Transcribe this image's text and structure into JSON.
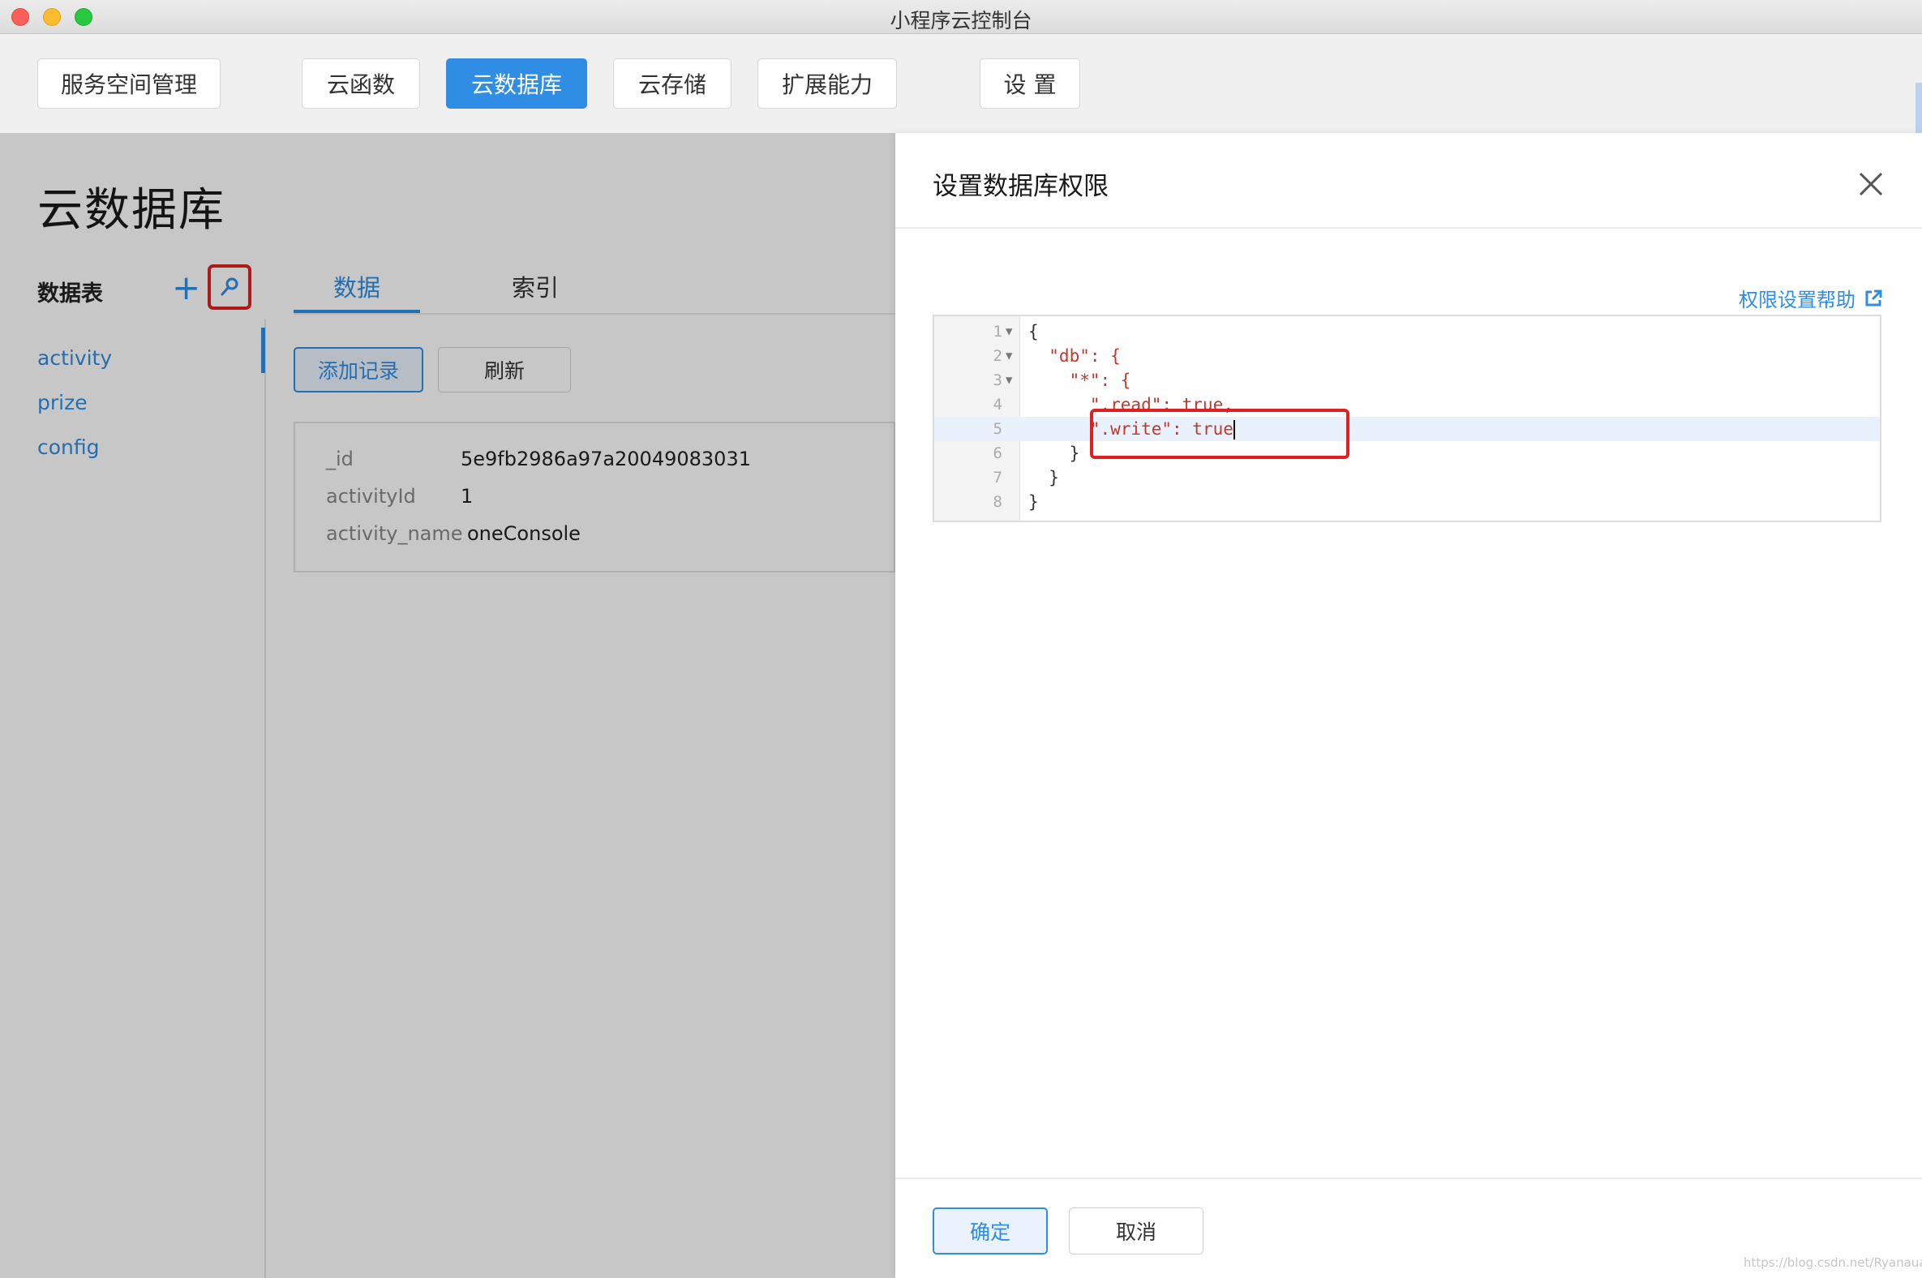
{
  "window": {
    "title": "小程序云控制台"
  },
  "nav": {
    "items": [
      {
        "label": "服务空间管理"
      },
      {
        "label": "云函数"
      },
      {
        "label": "云数据库"
      },
      {
        "label": "云存储"
      },
      {
        "label": "扩展能力"
      },
      {
        "label": "设 置"
      }
    ],
    "active": "云数据库"
  },
  "main": {
    "title": "云数据库",
    "tables_heading": "数据表",
    "add_icon": "plus-icon",
    "search_icon": "search-key-icon",
    "tables": [
      {
        "label": "activity"
      },
      {
        "label": "prize"
      },
      {
        "label": "config"
      }
    ],
    "tabs": [
      {
        "label": "数据"
      },
      {
        "label": "索引"
      }
    ],
    "add_record_label": "添加记录",
    "refresh_label": "刷新",
    "record": [
      {
        "key": "_id",
        "value": "5e9fb2986a97a20049083031"
      },
      {
        "key": "activityId",
        "value": "1"
      },
      {
        "key": "activity_name",
        "value": "oneConsole"
      }
    ]
  },
  "drawer": {
    "title": "设置数据库权限",
    "help_link": "权限设置帮助",
    "editor_lines": [
      {
        "num": "1",
        "text": "{"
      },
      {
        "num": "2",
        "text": "  \"db\": {"
      },
      {
        "num": "3",
        "text": "    \"*\": {"
      },
      {
        "num": "4",
        "text": "      \".read\": true,"
      },
      {
        "num": "5",
        "text": "      \".write\": true"
      },
      {
        "num": "6",
        "text": "    }"
      },
      {
        "num": "7",
        "text": "  }"
      },
      {
        "num": "8",
        "text": "}"
      }
    ],
    "ok_label": "确定",
    "cancel_label": "取消"
  },
  "watermark": "https://blog.csdn.net/Ryanaua",
  "colors": {
    "accent": "#2f8de4",
    "highlight": "#e02020"
  }
}
